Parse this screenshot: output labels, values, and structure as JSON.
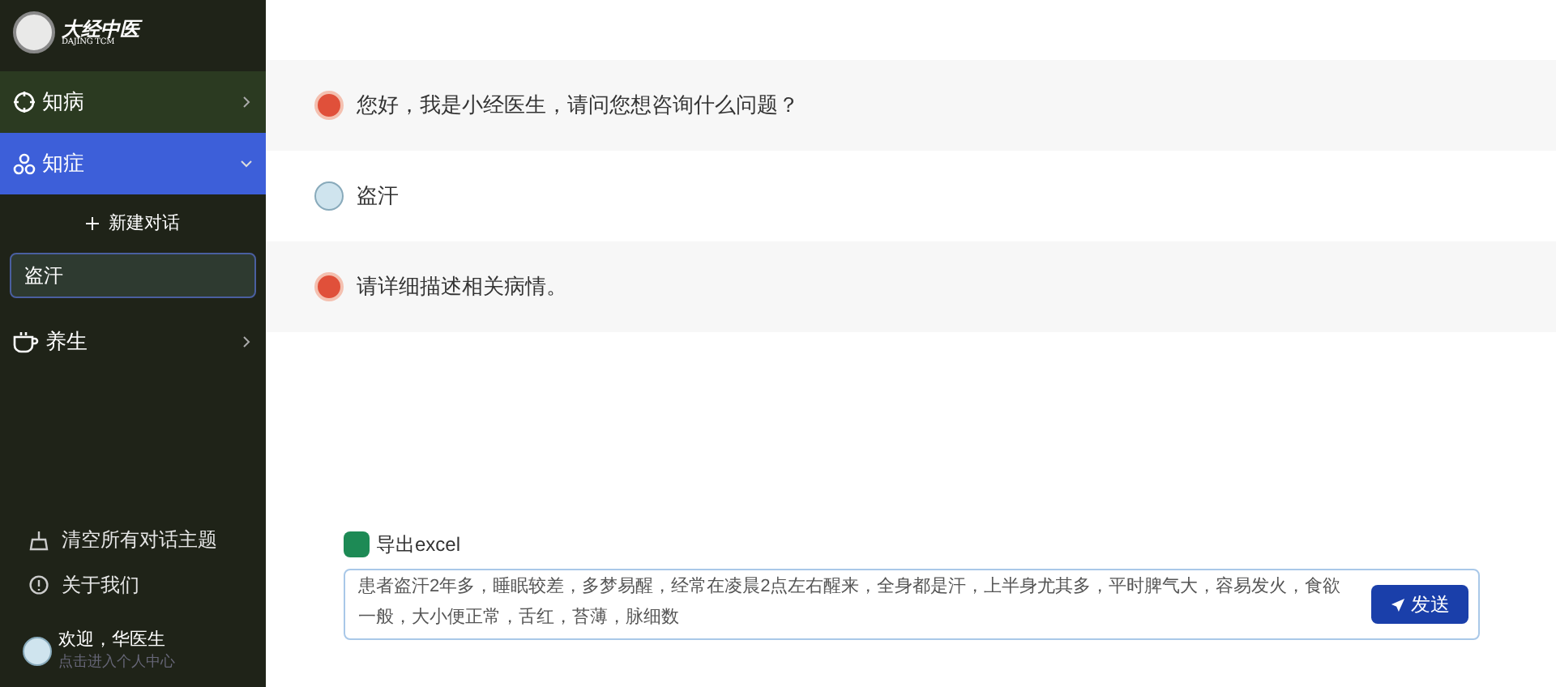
{
  "sidebar": {
    "logo": {
      "title": "大经中医",
      "subtitle": "DAJING TCM"
    },
    "menu": [
      {
        "label": "知病",
        "selected": false,
        "expanded": false
      },
      {
        "label": "知症",
        "selected": true,
        "expanded": true,
        "new_chat": "新建对话",
        "conversations": [
          {
            "label": "盗汗",
            "selected": true
          }
        ]
      },
      {
        "label": "养生",
        "selected": false,
        "expanded": false
      }
    ],
    "actions": [
      {
        "label": "清空所有对话主题"
      },
      {
        "label": "关于我们"
      }
    ],
    "user": {
      "greeting": "欢迎，华医生",
      "hint": "点击进入个人中心"
    }
  },
  "chat": {
    "messages": [
      {
        "kind": "doctor",
        "text": "您好，我是小经医生，请问您想咨询什么问题？"
      },
      {
        "kind": "user",
        "text": "盗汗"
      },
      {
        "kind": "doctor",
        "text": "请详细描述相关病情。"
      }
    ],
    "export": "导出excel",
    "input": {
      "value": "患者盗汗2年多，睡眠较差，多梦易醒，经常在凌晨2点左右醒来，全身都是汗，上半身尤其多，平时脾气大，容易发火，食欲一般，大小便正常，舌红，苔薄，脉细数"
    },
    "send": "发送"
  }
}
